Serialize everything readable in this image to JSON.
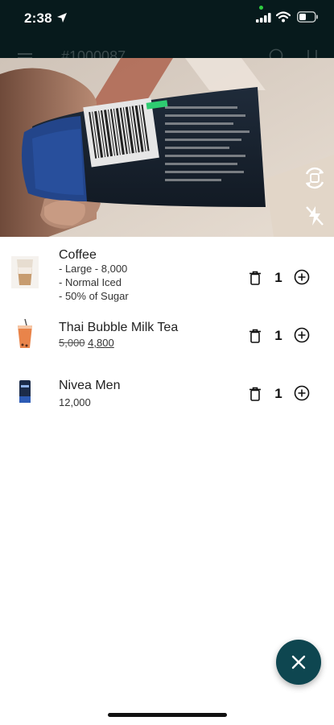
{
  "status_bar": {
    "time": "2:38"
  },
  "app_bar": {
    "order_number": "#1000087"
  },
  "cart": {
    "items": [
      {
        "name": "Coffee",
        "options": [
          "- Large - 8,000",
          "- Normal Iced",
          "- 50% of Sugar"
        ],
        "quantity": "1"
      },
      {
        "name": "Thai Bubble Milk Tea",
        "original_price": "5,000",
        "price": "4,800",
        "quantity": "1"
      },
      {
        "name": "Nivea Men",
        "price": "12,000",
        "quantity": "1"
      }
    ]
  },
  "colors": {
    "header_bg": "#071a1c",
    "fab_bg": "#0e4650",
    "scan_indicator": "#2ecc71"
  },
  "icons": {
    "location": "location-arrow-icon",
    "signal": "cellular-signal-icon",
    "wifi": "wifi-icon",
    "battery": "battery-icon",
    "camera_switch": "camera-rotate-icon",
    "flash": "flash-off-icon",
    "delete": "trash-icon",
    "add": "plus-circle-icon",
    "close": "close-icon"
  }
}
